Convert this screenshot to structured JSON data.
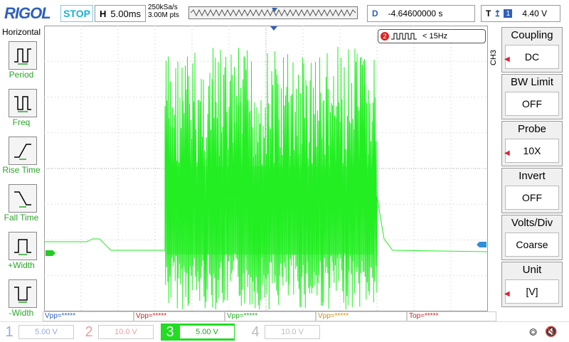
{
  "brand": "RIGOL",
  "run_state": "STOP",
  "timebase": {
    "key": "H",
    "value": "5.00ms"
  },
  "sample": {
    "rate": "250kSa/s",
    "points": "3.00M pts"
  },
  "delay": {
    "key": "D",
    "value": "-4.64600000 s"
  },
  "trigger": {
    "key": "T",
    "source": "1",
    "level": "4.40 V"
  },
  "left_menu": {
    "title": "Horizontal",
    "items": [
      {
        "label": "Period"
      },
      {
        "label": "Freq"
      },
      {
        "label": "Rise Time"
      },
      {
        "label": "Fall Time"
      },
      {
        "label": "+Width"
      },
      {
        "label": "-Width"
      }
    ]
  },
  "freq_badge": {
    "channel": "2",
    "text": "< 15Hz"
  },
  "channel_label": "CH3",
  "right_menu": [
    {
      "title": "Coupling",
      "value": "DC"
    },
    {
      "title": "BW Limit",
      "value": "OFF"
    },
    {
      "title": "Probe",
      "value": "10X"
    },
    {
      "title": "Invert",
      "value": "OFF"
    },
    {
      "title": "Volts/Div",
      "value": "Coarse"
    },
    {
      "title": "Unit",
      "value": "[V]"
    }
  ],
  "measurements": [
    {
      "text": "Vpp=*****",
      "color": "#2f60b8"
    },
    {
      "text": "Vpp=*****",
      "color": "#cc2222"
    },
    {
      "text": "Vpp=*****",
      "color": "#22aa22"
    },
    {
      "text": "Vpp=*****",
      "color": "#e08a00"
    },
    {
      "text": "Top=*****",
      "color": "#cc2222"
    }
  ],
  "channels": [
    {
      "num": "1",
      "value": "5.00 V",
      "color": "#9aa8d8",
      "active": false
    },
    {
      "num": "2",
      "value": "10.0 V",
      "color": "#e8a0a0",
      "active": false
    },
    {
      "num": "3",
      "value": "5.00 V",
      "color": "#22dd22",
      "active": true
    },
    {
      "num": "4",
      "value": "10.0 V",
      "color": "#bbbbbb",
      "active": false
    }
  ],
  "colors": {
    "trace": "#22ee22",
    "accent": "#2f60b8",
    "grid": "#c8c8c8"
  },
  "icons": {
    "usb": "usb-icon",
    "speaker": "speaker-mute-icon"
  }
}
